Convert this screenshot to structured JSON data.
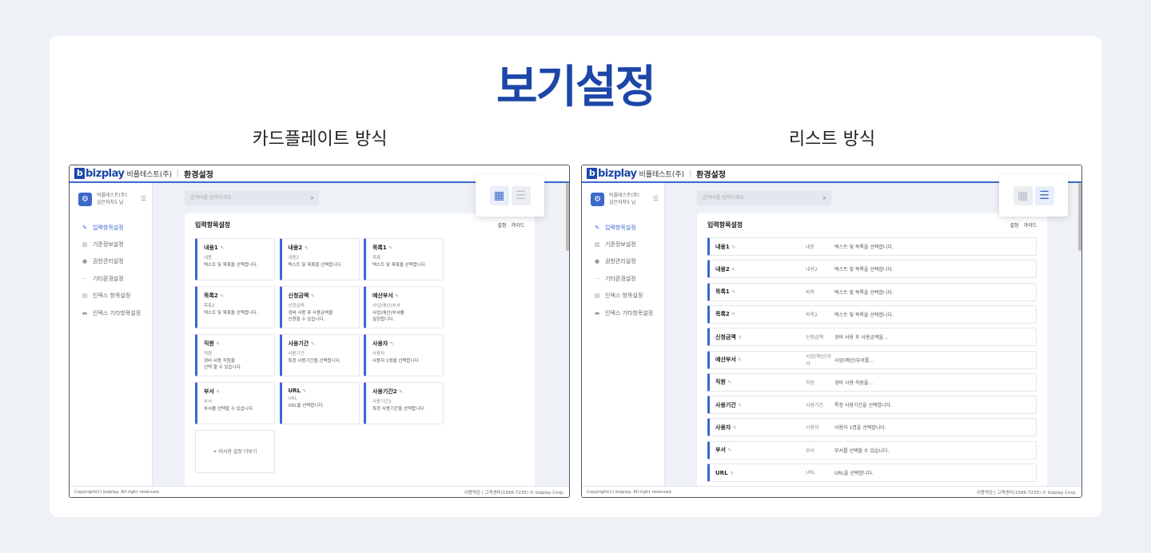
{
  "page_title": "보기설정",
  "left_label": "카드플레이트 방식",
  "right_label": "리스트 방식",
  "app": {
    "logo": "bizplay",
    "company": "비플테스트(주)",
    "page": "환경설정",
    "profile_company": "비플테스트(주)",
    "profile_user": "심은지차5 님",
    "search_placeholder": "검색어를 입력하세요",
    "content_title": "입력항목설정",
    "link_settings": "설정",
    "link_guide": "가이드",
    "menu": [
      {
        "label": "입력항목설정",
        "icon": "pencil-icon",
        "active": true
      },
      {
        "label": "기준정보설정",
        "icon": "bar-chart-icon"
      },
      {
        "label": "권한관리설정",
        "icon": "user-icon"
      },
      {
        "label": "기타환경설정",
        "icon": "more-icon"
      },
      {
        "label": "인덱스 항목설정",
        "icon": "table-icon"
      },
      {
        "label": "인덱스 기타항목설정",
        "icon": "card-icon"
      }
    ],
    "footer_left": "Copyright(c) bizplay. All right reserved.",
    "footer_terms": "이용약관",
    "footer_center": "고객센터(1566-7235)",
    "footer_corp": "© bizplay Corp.",
    "add_more": "미사용 설정 더보기"
  },
  "cards": [
    {
      "name": "내용1",
      "sub": "내용",
      "desc1": "텍스트 및 목록을 선택합니다.",
      "desc2": ""
    },
    {
      "name": "내용2",
      "sub": "내용2",
      "desc1": "텍스트 및 목록을 선택합니다.",
      "desc2": ""
    },
    {
      "name": "목록1",
      "sub": "목록",
      "desc1": "텍스트 및 목록을 선택합니다.",
      "desc2": ""
    },
    {
      "name": "목록2",
      "sub": "목록2",
      "desc1": "텍스트 및 목록을 선택합니다.",
      "desc2": ""
    },
    {
      "name": "신청금액",
      "sub": "신청금액",
      "desc1": "경비 사용 후 사용금액을",
      "desc2": "신청할 수 있습니다."
    },
    {
      "name": "예산부서",
      "sub": "사업(예산)부서",
      "desc1": "사업(예산)부서를",
      "desc2": "설정합니다."
    },
    {
      "name": "직원",
      "sub": "직원",
      "desc1": "경비 사용 직원을",
      "desc2": "선택 할 수 있습니다."
    },
    {
      "name": "사용기간",
      "sub": "사용기간",
      "desc1": "특정 사용기간을 선택합니다.",
      "desc2": ""
    },
    {
      "name": "사용자",
      "sub": "사용자",
      "desc1": "사용자 1명을 선택합니다.",
      "desc2": ""
    },
    {
      "name": "부서",
      "sub": "부서",
      "desc1": "부서를 선택할 수 있습니다.",
      "desc2": ""
    },
    {
      "name": "URL",
      "sub": "URL",
      "desc1": "URL을 선택합니다.",
      "desc2": ""
    },
    {
      "name": "사용기간2",
      "sub": "사용기간2",
      "desc1": "특정 사용기간을 선택합니다.",
      "desc2": ""
    }
  ],
  "rows": [
    {
      "name": "내용1",
      "sub": "내용",
      "desc": "텍스트 및 목록을 선택합니다."
    },
    {
      "name": "내용2",
      "sub": "내용2",
      "desc": "텍스트 및 목록을 선택합니다."
    },
    {
      "name": "목록1",
      "sub": "목록",
      "desc": "텍스트 및 목록을 선택합니다."
    },
    {
      "name": "목록2",
      "sub": "목록2",
      "desc": "텍스트 및 목록을 선택합니다."
    },
    {
      "name": "신청금액",
      "sub": "신청금액",
      "desc": "경비 사용 후 사용금액을…"
    },
    {
      "name": "예산부서",
      "sub": "사업(예산)부서",
      "desc": "사업(예산)부서를…"
    },
    {
      "name": "직원",
      "sub": "직원",
      "desc": "경비 사용 직원을…"
    },
    {
      "name": "사용기간",
      "sub": "사용기간",
      "desc": "특정 사용기간을 선택합니다."
    },
    {
      "name": "사용자",
      "sub": "사용자",
      "desc": "사용자 1명을 선택합니다."
    },
    {
      "name": "부서",
      "sub": "부서",
      "desc": "부서를 선택할 수 있습니다."
    },
    {
      "name": "URL",
      "sub": "URL",
      "desc": "URL을 선택합니다."
    }
  ],
  "colors": {
    "accent": "#1c47a8",
    "brand_blue": "#3b68c9",
    "bg": "#eef1f6"
  }
}
